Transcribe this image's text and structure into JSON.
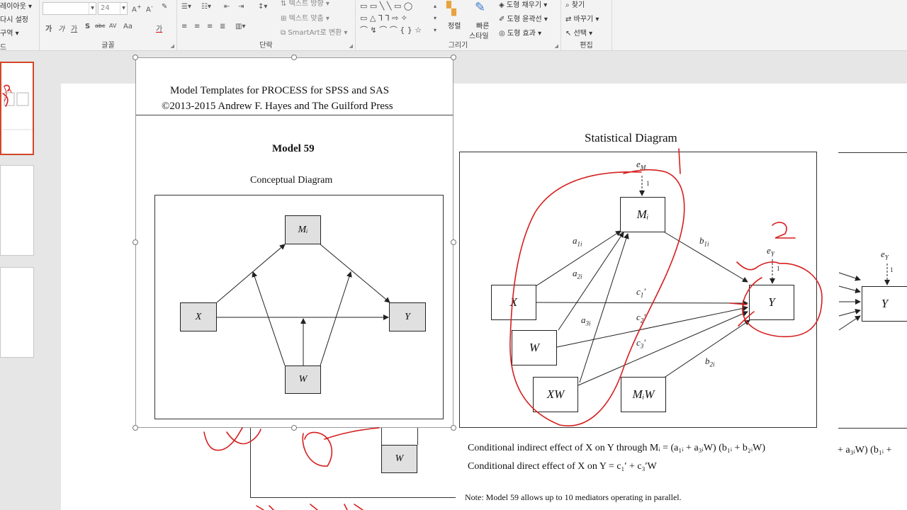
{
  "ribbon": {
    "slides_group": {
      "layout_label": "레이아웃",
      "reset_label": "다시 설정",
      "section_label": "구역",
      "group_label": "드"
    },
    "font_group": {
      "font_size_value": "24",
      "group_label": "글꼴",
      "tools": [
        "가",
        "가",
        "가",
        "S",
        "abc",
        "AV",
        "Aa",
        "가"
      ]
    },
    "paragraph_group": {
      "text_direction_label": "텍스트 방향",
      "align_text_label": "텍스트 맞춤",
      "smartart_label": "SmartArt로 변환",
      "group_label": "단락"
    },
    "drawing_group": {
      "arrange_label": "정렬",
      "quick_styles_label_1": "빠른",
      "quick_styles_label_2": "스타일",
      "shape_fill_label": "도형 채우기",
      "shape_outline_label": "도형 윤곽선",
      "shape_effects_label": "도형 효과",
      "group_label": "그리기"
    },
    "editing_group": {
      "find_label": "찾기",
      "replace_label": "바꾸기",
      "select_label": "선택",
      "group_label": "편집"
    }
  },
  "slide": {
    "header_line1": "Model Templates for PROCESS for SPSS and SAS",
    "header_line2": "©2013-2015 Andrew F. Hayes and The Guilford Press",
    "model_title": "Model 59",
    "conceptual_title": "Conceptual Diagram",
    "conceptual_nodes": {
      "m": "Mᵢ",
      "x": "X",
      "y": "Y",
      "w": "W"
    },
    "statistical_title": "Statistical Diagram",
    "statistical_nodes": {
      "m": "Mᵢ",
      "x": "X",
      "w": "W",
      "xw": "XW",
      "mw": "MᵢW",
      "y": "Y",
      "y_right": "Y"
    },
    "error_labels": {
      "em": "e",
      "em_sub": "Mᵢ",
      "ey": "e",
      "ey_sub": "Y",
      "ey_right": "e",
      "ey_right_sub": "Y",
      "one_m": "1",
      "one_y": "1",
      "one_y_right": "1"
    },
    "paths": {
      "a1": "a",
      "a1_sub": "1i",
      "a2": "a",
      "a2_sub": "2i",
      "a3": "a",
      "a3_sub": "3i",
      "b1": "b",
      "b1_sub": "1i",
      "b2": "b",
      "b2_sub": "2i",
      "c1": "c",
      "c1_sub": "1",
      "c2": "c",
      "c2_sub": "2",
      "c3": "c",
      "c3_sub": "3"
    },
    "indirect_effect_text": "Conditional indirect effect of X on Y through Mᵢ = (a₁ᵢ + a₃ᵢW) (b₁ᵢ + b₂ᵢW)",
    "direct_effect_text": "Conditional direct effect of X on Y = c₁′ + c₃′W",
    "indirect_effect_fragment": "+ a₃ᵢW) (b₁ᵢ +",
    "note_text": "Note: Model 59 allows up to 10 mediators operating in parallel.",
    "lower_w_node": "W",
    "annotation_marks": {
      "one": "1",
      "two": "2"
    }
  },
  "colors": {
    "ink_red": "#d61e1e",
    "accent": "#d24726",
    "node_grey": "#e0e0e0"
  }
}
